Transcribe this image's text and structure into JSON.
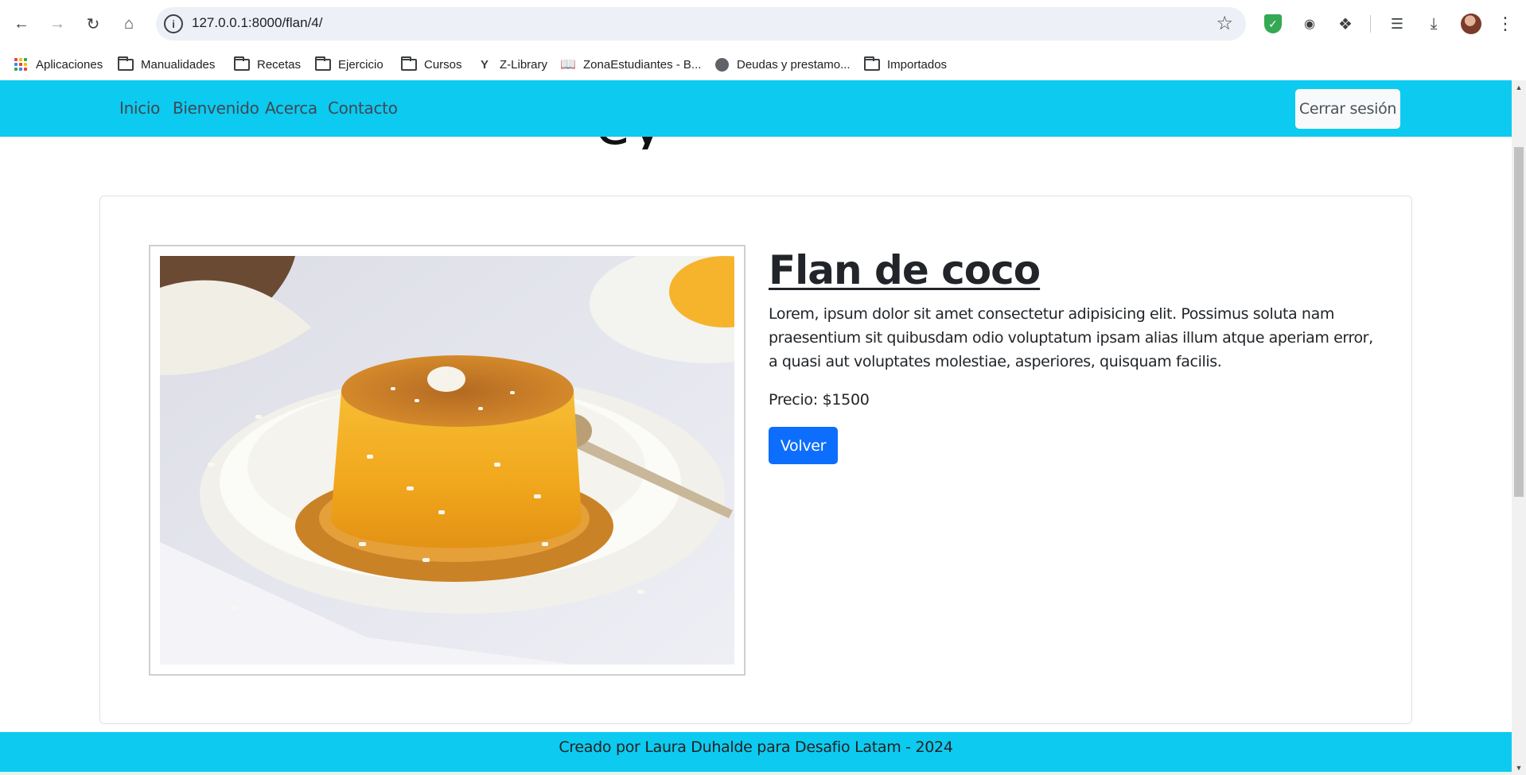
{
  "browser": {
    "url": "127.0.0.1:8000/flan/4/",
    "bookmarks": [
      {
        "label": "Aplicaciones",
        "icon": "apps-grid-icon"
      },
      {
        "label": "Manualidades",
        "icon": "folder-icon"
      },
      {
        "label": "Recetas",
        "icon": "folder-icon"
      },
      {
        "label": "Ejercicio",
        "icon": "folder-icon"
      },
      {
        "label": "Cursos",
        "icon": "folder-icon"
      },
      {
        "label": "Z-Library",
        "icon": "zlibrary-icon"
      },
      {
        "label": "ZonaEstudiantes - B...",
        "icon": "book-icon"
      },
      {
        "label": "Deudas y prestamo...",
        "icon": "globe-icon"
      },
      {
        "label": "Importados",
        "icon": "folder-icon"
      }
    ]
  },
  "navbar": {
    "links": [
      "Inicio",
      "Bienvenido",
      "Acerca",
      "Contacto"
    ],
    "logout_label": "Cerrar sesión"
  },
  "product": {
    "title": "Flan de coco",
    "description": "Lorem, ipsum dolor sit amet consectetur adipisicing elit. Possimus soluta nam praesentium sit quibusdam odio voluptatum ipsam alias illum atque aperiam error, a quasi aut voluptates molestiae, asperiores, quisquam facilis.",
    "price": "Precio: $1500",
    "back_label": "Volver"
  },
  "footer": {
    "text": "Creado por Laura Duhalde para Desafio Latam - 2024"
  },
  "colors": {
    "navbar": "#0dcaf0",
    "primary_button": "#0d6efd",
    "text": "#212529"
  }
}
